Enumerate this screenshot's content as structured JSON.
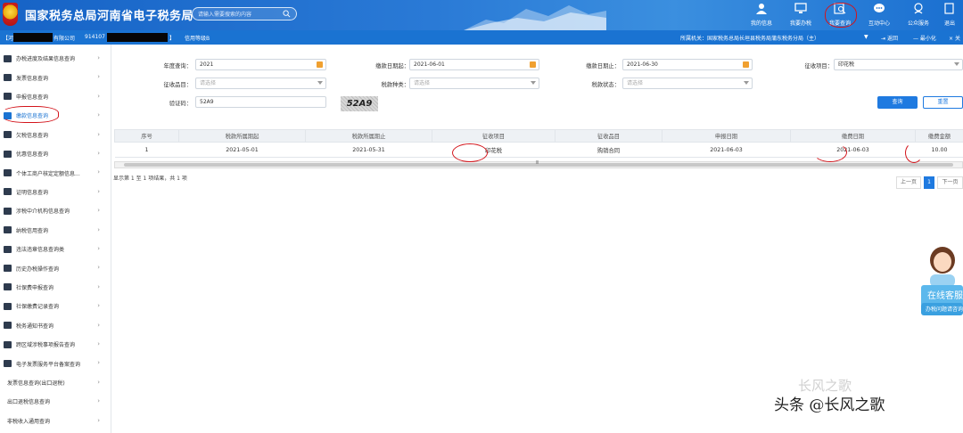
{
  "header": {
    "title": "国家税务总局河南省电子税务局",
    "search_placeholder": "请输入需要搜索的内容",
    "nav": [
      {
        "label": "我的信息",
        "icon": "user-icon"
      },
      {
        "label": "我要办税",
        "icon": "monitor-icon"
      },
      {
        "label": "我要查询",
        "icon": "search-doc-icon"
      },
      {
        "label": "互动中心",
        "icon": "chat-icon"
      },
      {
        "label": "公众服务",
        "icon": "people-icon"
      },
      {
        "label": "退出",
        "icon": "exit-icon"
      }
    ]
  },
  "subbar": {
    "company_prefix": "【河",
    "company_suffix": "有限公司",
    "tax_id_prefix": "914107",
    "tax_id_suffix": "】",
    "credit_level": "信用等级B",
    "authority_label": "所属机关：",
    "authority_value": "国家税务总局长垣县税务局蒲东税务分局（主）",
    "back": "返回",
    "minimize": "最小化",
    "close": "关"
  },
  "sidebar": {
    "items": [
      {
        "label": "办税进度及结果信息查询"
      },
      {
        "label": "发票信息查询"
      },
      {
        "label": "申报信息查询"
      },
      {
        "label": "缴款信息查询"
      },
      {
        "label": "欠税信息查询"
      },
      {
        "label": "优惠信息查询"
      },
      {
        "label": "个体工商户核定定额信息..."
      },
      {
        "label": "证明信息查询"
      },
      {
        "label": "涉税中介机构信息查询"
      },
      {
        "label": "纳税信用查询"
      },
      {
        "label": "违法违章信息查询类"
      },
      {
        "label": "历史办税操作查询"
      },
      {
        "label": "社保费申报查询"
      },
      {
        "label": "社保缴费记录查询"
      },
      {
        "label": "税务通知书查询"
      },
      {
        "label": "跨区域涉税事项报告查询"
      },
      {
        "label": "电子发票服务平台备案查询"
      },
      {
        "label": "发票信息查询(出口退税)"
      },
      {
        "label": "出口退税信息查询"
      },
      {
        "label": "非税收入通用查询"
      }
    ],
    "active_index": 3
  },
  "form": {
    "year_label": "年度查询：",
    "year_value": "2021",
    "pay_start_label": "缴款日期起：",
    "pay_start_value": "2021-06-01",
    "pay_end_label": "缴款日期止：",
    "pay_end_value": "2021-06-30",
    "levy_item_label": "征收项目：",
    "levy_item_value": "印花税",
    "levy_subitem_label": "征收品目：",
    "levy_subitem_placeholder": "请选择",
    "tax_type_label": "税款种类：",
    "tax_type_placeholder": "请选择",
    "tax_status_label": "税款状态：",
    "tax_status_placeholder": "请选择",
    "captcha_label": "验证码：",
    "captcha_value": "52A9",
    "captcha_image_text": "52A9",
    "query_button": "查询",
    "reset_button": "重置"
  },
  "table": {
    "columns": [
      "序号",
      "税款所属期起",
      "税款所属期止",
      "征收项目",
      "征收品目",
      "申报日期",
      "缴费日期",
      "缴费金额"
    ],
    "rows": [
      [
        "1",
        "2021-05-01",
        "2021-05-31",
        "印花税",
        "购销合同",
        "2021-06-03",
        "2021-06-03",
        "10.00"
      ]
    ],
    "scroll_mark": "Ⅲ"
  },
  "pagination": {
    "info": "显示第 1 至 1 项结果，共 1 项",
    "prev": "上一页",
    "current": "1",
    "next": "下一页"
  },
  "customer_service": {
    "title": "在线客服",
    "subtitle": "办税问题请咨询"
  },
  "watermark": {
    "line1": "长风之歌",
    "line2": "头条 @长风之歌"
  },
  "colors": {
    "header_blue": "#1663c6",
    "subbar_blue": "#1a73d2",
    "primary_button": "#1f7ae0",
    "annotation_red": "#d3141b"
  }
}
